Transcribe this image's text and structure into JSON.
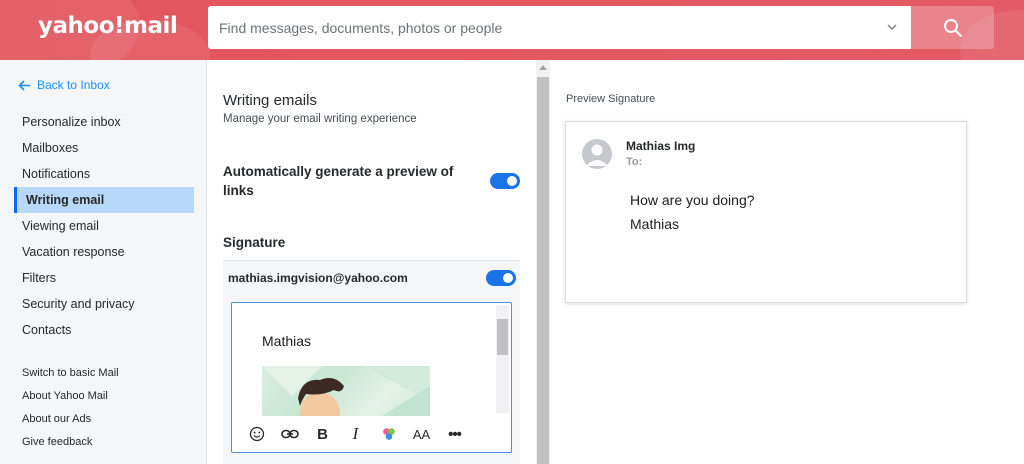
{
  "header": {
    "logo_text": "yahoo!mail",
    "search_placeholder": "Find messages, documents, photos or people"
  },
  "sidebar": {
    "back_label": "Back to Inbox",
    "items": [
      {
        "label": "Personalize inbox",
        "active": false
      },
      {
        "label": "Mailboxes",
        "active": false
      },
      {
        "label": "Notifications",
        "active": false
      },
      {
        "label": "Writing email",
        "active": true
      },
      {
        "label": "Viewing email",
        "active": false
      },
      {
        "label": "Vacation response",
        "active": false
      },
      {
        "label": "Filters",
        "active": false
      },
      {
        "label": "Security and privacy",
        "active": false
      },
      {
        "label": "Contacts",
        "active": false
      }
    ],
    "links": [
      {
        "label": "Switch to basic Mail"
      },
      {
        "label": "About Yahoo Mail"
      },
      {
        "label": "About our Ads"
      },
      {
        "label": "Give feedback"
      }
    ]
  },
  "settings": {
    "title": "Writing emails",
    "subtitle": "Manage your email writing experience",
    "auto_preview_label": "Automatically generate a preview of links",
    "auto_preview_on": true,
    "signature_heading": "Signature",
    "signature_account": "mathias.imgvision@yahoo.com",
    "signature_on": true,
    "signature_text": "Mathias"
  },
  "toolbar": {
    "bold_label": "B",
    "italic_label": "I",
    "font_size_label": "AA",
    "more_label": "•••"
  },
  "preview": {
    "label": "Preview Signature",
    "sender_name": "Mathias Img",
    "to_label": "To:",
    "body_line1": "How are you doing?",
    "body_line2": "Mathias"
  },
  "colors": {
    "header_bg": "#e2545e",
    "accent": "#188fff",
    "active_nav_bg": "#b8d8f9",
    "toggle_on": "#1a73e8"
  }
}
